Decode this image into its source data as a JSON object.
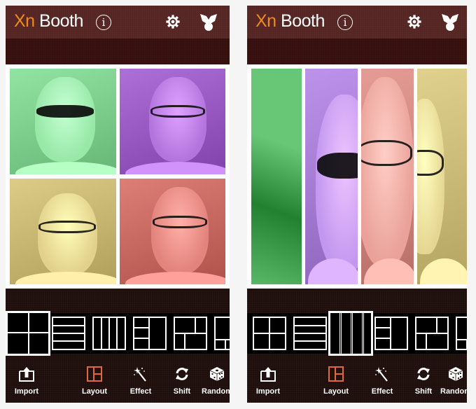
{
  "app": {
    "title_prefix": "Xn",
    "title_suffix": "Booth",
    "accent_color": "#f08a1c",
    "active_tool_color": "#e0683e",
    "header_color": "#5a2927",
    "icons": {
      "info": "info-icon",
      "settings": "gear-icon",
      "share": "share-icon"
    }
  },
  "screens": [
    {
      "id": "left",
      "layout_name": "2x2 grid",
      "selected_layout_index": 0,
      "photos": [
        {
          "tint": "green",
          "color": "#7fcf8e",
          "accessory": "sunglasses"
        },
        {
          "tint": "purple",
          "color": "#9a5cc4",
          "accessory": "glasses"
        },
        {
          "tint": "yellow",
          "color": "#c9b873",
          "accessory": "glasses"
        },
        {
          "tint": "red",
          "color": "#c96a63",
          "accessory": "glasses"
        }
      ]
    },
    {
      "id": "right",
      "layout_name": "4 vertical strips",
      "selected_layout_index": 2,
      "photos": [
        {
          "tint": "green",
          "color": "#4fae5e",
          "accessory": "none"
        },
        {
          "tint": "purple",
          "color": "#a97ed6",
          "accessory": "sunglasses"
        },
        {
          "tint": "red",
          "color": "#d08880",
          "accessory": "glasses"
        },
        {
          "tint": "yellow",
          "color": "#cdbd7a",
          "accessory": "glasses"
        }
      ]
    }
  ],
  "layouts": [
    {
      "name": "2x2 grid"
    },
    {
      "name": "4 horizontal rows"
    },
    {
      "name": "4 vertical columns"
    },
    {
      "name": "3 left stack + right tall"
    },
    {
      "name": "top split + bottom split"
    },
    {
      "name": "mixed grid"
    }
  ],
  "toolbar": {
    "items": [
      {
        "label": "Import",
        "icon": "import-icon"
      },
      {
        "label": "Layout",
        "icon": "layout-icon",
        "active": true
      },
      {
        "label": "Effect",
        "icon": "magic-wand-icon"
      },
      {
        "label": "Shift",
        "icon": "shift-arrows-icon"
      },
      {
        "label": "Random",
        "icon": "dice-icon"
      }
    ]
  }
}
